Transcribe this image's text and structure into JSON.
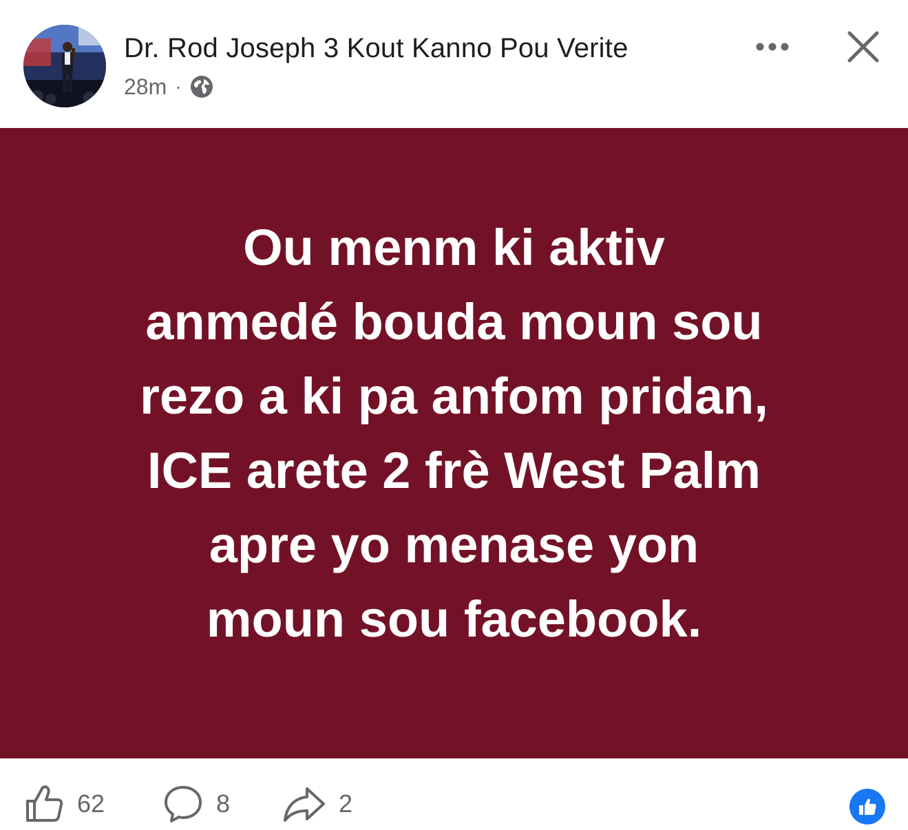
{
  "post": {
    "author_name": "Dr. Rod Joseph 3 Kout Kanno Pou Verite",
    "timestamp": "28m",
    "separator": "·",
    "privacy_icon": "globe-icon",
    "background_color": "#731226",
    "text_lines": [
      "Ou menm ki aktiv",
      "anmedé bouda moun sou",
      "rezo a ki pa anfom pridan,",
      "ICE arete 2 frè West Palm",
      "apre yo menase yon",
      "moun sou facebook."
    ]
  },
  "header_actions": {
    "more_icon": "ellipsis-icon",
    "close_icon": "close-icon"
  },
  "footer": {
    "likes": "62",
    "comments": "8",
    "shares": "2",
    "like_icon": "thumbs-up-icon",
    "comment_icon": "comment-icon",
    "share_icon": "share-icon",
    "reaction_icon": "like-reaction-icon",
    "reaction_color": "#1877f2"
  }
}
